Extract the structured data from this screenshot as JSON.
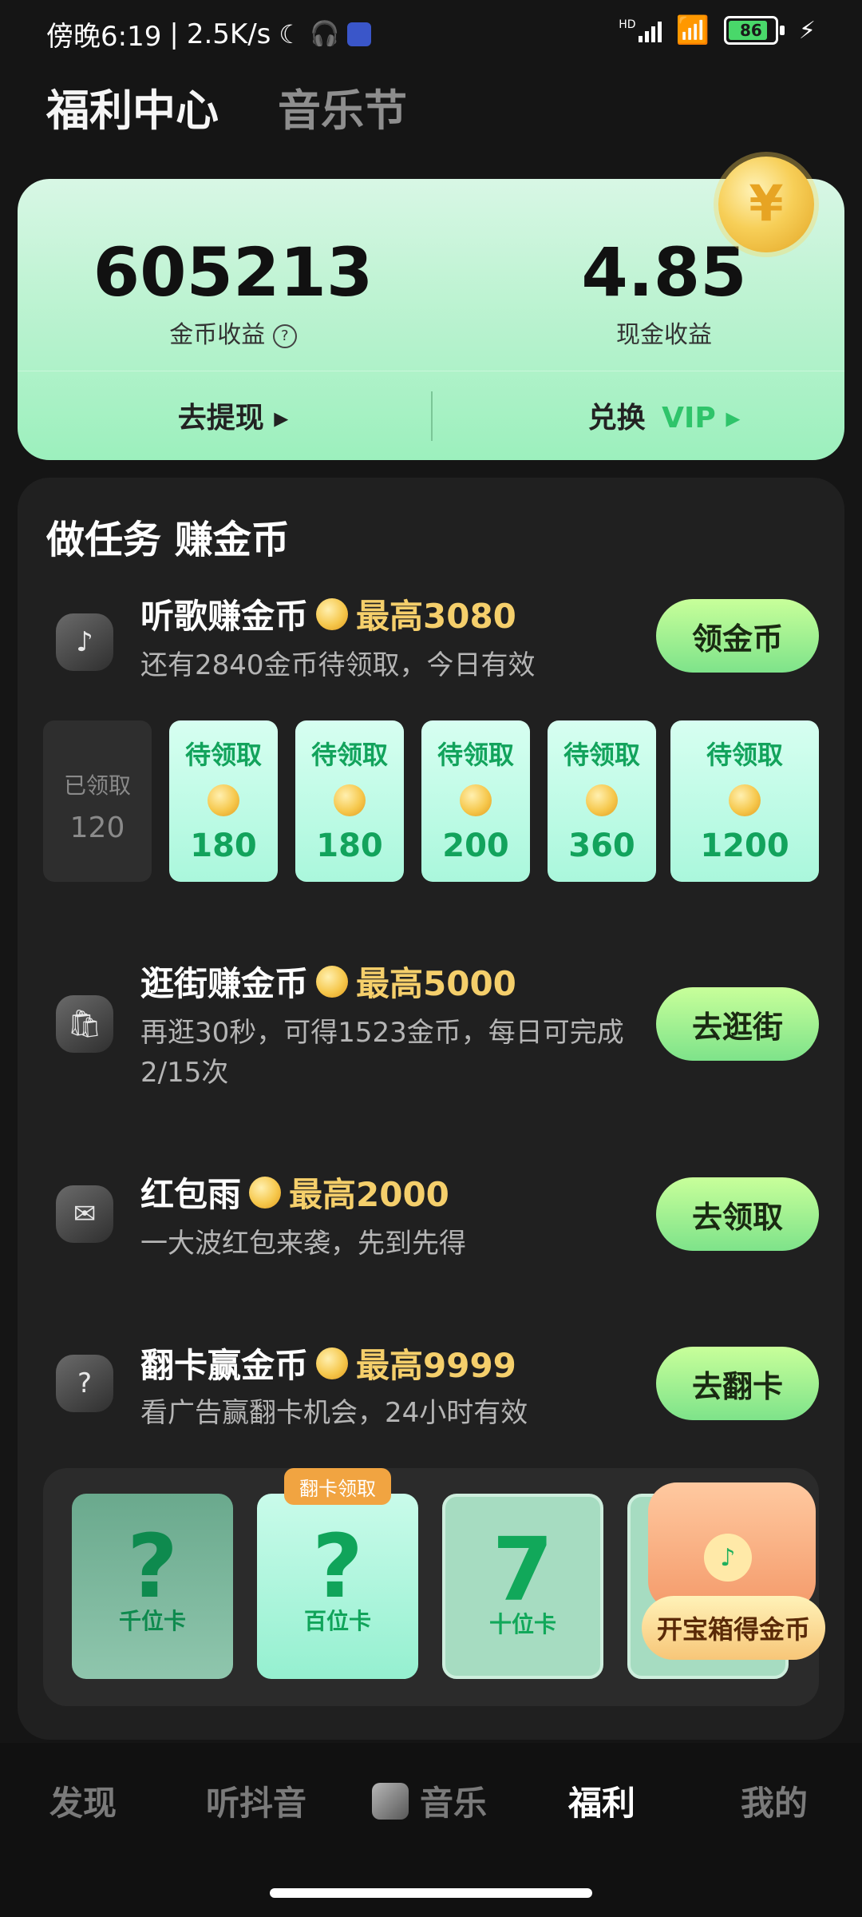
{
  "status_bar": {
    "time": "傍晚6:19",
    "speed": "2.5K/s",
    "network": "HD",
    "battery": "86",
    "battery_level": 0.86
  },
  "header": {
    "active_tab": "福利中心",
    "inactive_tab": "音乐节"
  },
  "earnings": {
    "coins_value": "605213",
    "coins_label": "金币收益",
    "cash_value": "4.85",
    "cash_label": "现金收益",
    "withdraw_label": "去提现 ▸",
    "vip_label_prefix": "兑换",
    "vip_label": "VIP ▸"
  },
  "tasks": {
    "title": "做任务 赚金币",
    "listen": {
      "title": "听歌赚金币",
      "max": "最高3080",
      "desc": "还有2840金币待领取，今日有效",
      "button": "领金币"
    },
    "rewards": {
      "claimed_label": "已领取",
      "claimed_value": "120",
      "pending_label": "待领取",
      "pending_values": [
        "180",
        "180",
        "200",
        "360",
        "1200"
      ]
    },
    "shop": {
      "title": "逛街赚金币",
      "max": "最高5000",
      "desc_line1": "再逛30秒，可得1523金币，每日可完成",
      "desc_line2": "2/15次",
      "button": "去逛街"
    },
    "redpacket": {
      "title": "红包雨",
      "max": "最高2000",
      "desc": "一大波红包来袭，先到先得",
      "button": "去领取"
    },
    "flipcard": {
      "title": "翻卡赢金币",
      "max": "最高9999",
      "desc": "看广告赢翻卡机会，24小时有效",
      "button": "去翻卡"
    },
    "flip_cards": {
      "badge": "翻卡领取",
      "card1_symbol": "?",
      "card1_label": "千位卡",
      "card2_symbol": "?",
      "card2_label": "百位卡",
      "card3_symbol": "7",
      "card3_label": "十位卡",
      "chest_button": "开宝箱得金币"
    }
  },
  "bottom_nav": {
    "items": [
      "发现",
      "听抖音",
      "音乐",
      "福利",
      "我的"
    ],
    "active": "福利"
  },
  "colors": {
    "accent_green": "#7ee38a",
    "coin_gold": "#f6c84d",
    "max_text": "#f5cf6b"
  }
}
